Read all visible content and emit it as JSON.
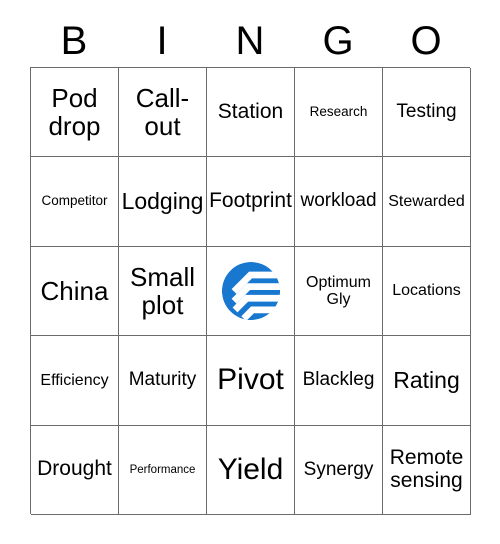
{
  "card": {
    "title": "BINGO",
    "header_letters": [
      "B",
      "I",
      "N",
      "G",
      "O"
    ],
    "accent_color": "#1878d0",
    "border_color": "#6b6b6b",
    "background_color": "#ffffff",
    "text_color": "#000000",
    "grid_size": "5x5"
  },
  "squares": [
    [
      {
        "label": "Pod drop",
        "size": "xl"
      },
      {
        "label": "Call-out",
        "size": "xl"
      },
      {
        "label": "Station",
        "size": "ml"
      },
      {
        "label": "Research",
        "size": "xs"
      },
      {
        "label": "Testing",
        "size": "md"
      }
    ],
    [
      {
        "label": "Competitor",
        "size": "xs"
      },
      {
        "label": "Lodging",
        "size": "lg"
      },
      {
        "label": "Footprint",
        "size": "ml"
      },
      {
        "label": "workload",
        "size": "md"
      },
      {
        "label": "Stewarded",
        "size": "sm"
      }
    ],
    [
      {
        "label": "China",
        "size": "xl"
      },
      {
        "label": "Small plot",
        "size": "xl"
      },
      {
        "label": "",
        "size": "md",
        "free_space": true,
        "icon": "company-logo-icon"
      },
      {
        "label": "Optimum Gly",
        "size": "sm"
      },
      {
        "label": "Locations",
        "size": "sm"
      }
    ],
    [
      {
        "label": "Efficiency",
        "size": "sm"
      },
      {
        "label": "Maturity",
        "size": "md"
      },
      {
        "label": "Pivot",
        "size": "xxl"
      },
      {
        "label": "Blackleg",
        "size": "md"
      },
      {
        "label": "Rating",
        "size": "lg"
      }
    ],
    [
      {
        "label": "Drought",
        "size": "ml"
      },
      {
        "label": "Performance",
        "size": "xxs"
      },
      {
        "label": "Yield",
        "size": "xxl"
      },
      {
        "label": "Synergy",
        "size": "md"
      },
      {
        "label": "Remote sensing",
        "size": "ml"
      }
    ]
  ]
}
